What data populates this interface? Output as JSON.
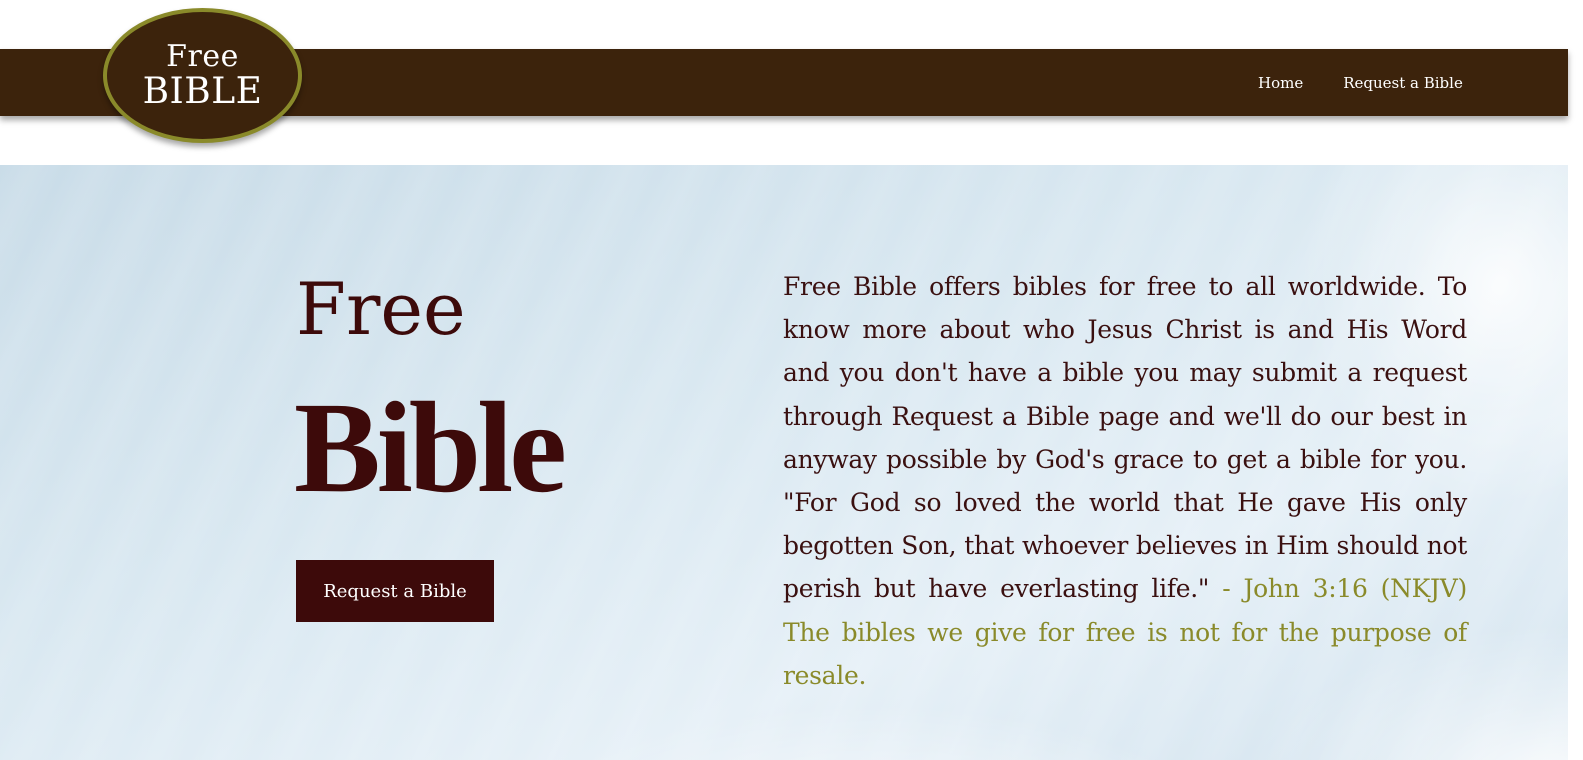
{
  "header": {
    "logo_line1": "Free",
    "logo_line2": "BIBLE",
    "nav": [
      {
        "label": "Home"
      },
      {
        "label": "Request a Bible"
      }
    ]
  },
  "hero": {
    "title_small": "Free",
    "title_large": "Bible",
    "cta_label": "Request a Bible",
    "description": "Free Bible offers bibles for free to all worldwide. To know more about who Jesus Christ is and His Word and you don't have a bible you may submit a request through Request a Bible page and we'll do our best in anyway possible by God's grace to get a bible for you. \"For God so loved the world that He gave His only begotten Son, that whoever believes in Him should not perish but have everlasting life.\"",
    "note": "- John 3:16 (NKJV) The bibles we give for free is not for the purpose of resale."
  },
  "colors": {
    "header_bg": "#3c230c",
    "logo_border": "#8a8a2a",
    "accent_text": "#8a8a2a",
    "primary_maroon": "#3d0a0a"
  }
}
